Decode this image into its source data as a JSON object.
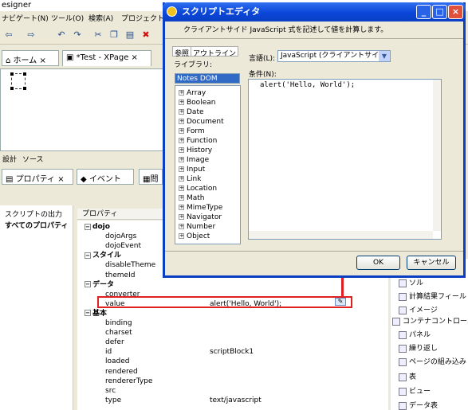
{
  "app": {
    "title": "esigner",
    "menu": [
      "ナビゲート(N)",
      "ツール(O)",
      "検索(A)",
      "プロジェクト(P"
    ],
    "editor_tabs": [
      "ホーム",
      "*Test - XPage"
    ],
    "source_tabs": [
      "設計",
      "ソース"
    ],
    "prop_tabs": [
      "プロパティ",
      "イベント",
      "問"
    ]
  },
  "left_panel": {
    "items": [
      "スクリプトの出力",
      "すべてのプロパティ"
    ]
  },
  "properties": {
    "header": "プロパティ",
    "rows": [
      {
        "label": "dojo",
        "category": true,
        "value": ""
      },
      {
        "label": "dojoArgs",
        "category": false,
        "value": ""
      },
      {
        "label": "dojoEvent",
        "category": false,
        "value": ""
      },
      {
        "label": "スタイル",
        "category": true,
        "value": ""
      },
      {
        "label": "disableTheme",
        "category": false,
        "value": ""
      },
      {
        "label": "themeId",
        "category": false,
        "value": ""
      },
      {
        "label": "データ",
        "category": true,
        "value": ""
      },
      {
        "label": "converter",
        "category": false,
        "value": ""
      },
      {
        "label": "value",
        "category": false,
        "value": "alert('Hello, World');"
      },
      {
        "label": "基本",
        "category": true,
        "value": ""
      },
      {
        "label": "binding",
        "category": false,
        "value": ""
      },
      {
        "label": "charset",
        "category": false,
        "value": ""
      },
      {
        "label": "defer",
        "category": false,
        "value": ""
      },
      {
        "label": "id",
        "category": false,
        "value": "scriptBlock1"
      },
      {
        "label": "loaded",
        "category": false,
        "value": ""
      },
      {
        "label": "rendered",
        "category": false,
        "value": ""
      },
      {
        "label": "rendererType",
        "category": false,
        "value": ""
      },
      {
        "label": "src",
        "category": false,
        "value": ""
      },
      {
        "label": "type",
        "category": false,
        "value": "text/javascript"
      }
    ]
  },
  "palette": {
    "items": [
      "ソル",
      "計算結果フィール",
      "イメージ",
      "コンテナコントロール",
      "パネル",
      "繰り返し",
      "ページの組み込み",
      "表",
      "ビュー",
      "データ表"
    ]
  },
  "dialog": {
    "title": "スクリプトエディタ",
    "description": "クライアントサイド JavaScript 式を記述して値を計算します。",
    "tabs": [
      "参照",
      "アウトライン"
    ],
    "library_label": "ライブラリ:",
    "library_selected": "Notes DOM",
    "library_items": [
      "Array",
      "Boolean",
      "Date",
      "Document",
      "Form",
      "Function",
      "History",
      "Image",
      "Input",
      "Link",
      "Location",
      "Math",
      "MimeType",
      "Navigator",
      "Number",
      "Object"
    ],
    "language_label": "言語(L):",
    "language_value": "JavaScript (クライアントサイド)",
    "condition_label": "条件(N):",
    "code": "alert('Hello, World');",
    "ok_label": "OK",
    "cancel_label": "キャンセル"
  },
  "colors": {
    "highlight": "#e02020",
    "title_bar": "#0a3fc4",
    "selection": "#316ac5"
  }
}
